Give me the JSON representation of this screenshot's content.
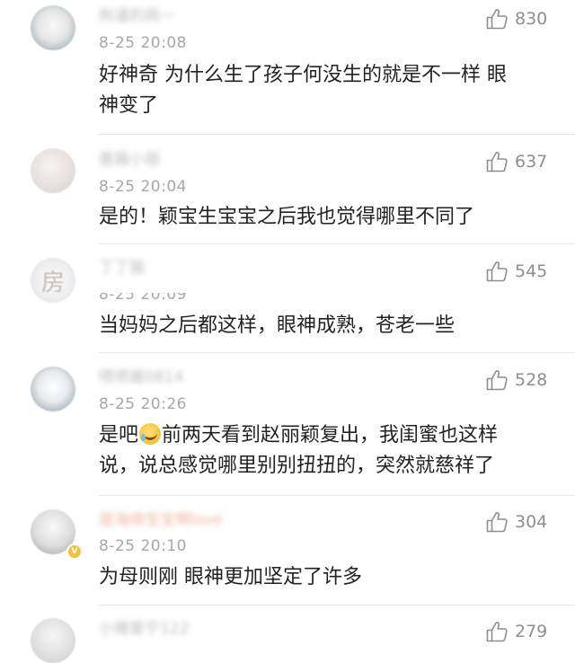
{
  "comments": [
    {
      "username": "拘谨的雨一",
      "timestamp": "8-25 20:08",
      "likes": "830",
      "text": "好神奇 为什么生了孩子何没生的就是不一样 眼\n神变了",
      "avatar_icon": "avatar-icon"
    },
    {
      "username": "蔷薇小丽",
      "timestamp": "8-25 20:04",
      "likes": "637",
      "text": "是的！颖宝生宝宝之后我也觉得哪里不同了",
      "avatar_icon": "avatar-icon"
    },
    {
      "username": "丁丁猫",
      "timestamp": "8-25 20:09",
      "likes": "545",
      "text": "当妈妈之后都这样，眼神成熟，苍老一些",
      "avatar_icon": "avatar-icon",
      "avatar_glyph": "房"
    },
    {
      "username": "喷喷酱0814",
      "timestamp": "8-25 20:26",
      "likes": "528",
      "text_before_emoji": "是吧",
      "emoji_icon": "laugh-cry-emoji-icon",
      "text_after_emoji": "前两天看到赵丽颖复出，我闺蜜也这样\n说，说总感觉哪里别别扭扭的，突然就慈祥了",
      "avatar_icon": "avatar-icon"
    },
    {
      "username": "是海绵宝宝啊love",
      "timestamp": "8-25 20:10",
      "likes": "304",
      "text": "为母则刚 眼神更加坚定了许多",
      "avatar_icon": "avatar-icon",
      "verified": true
    },
    {
      "username": "小猪爱宁122",
      "timestamp": "",
      "likes": "279",
      "text": "",
      "avatar_icon": "avatar-icon"
    }
  ],
  "icons": {
    "like": "thumbs-up-icon"
  },
  "colors": {
    "text": "#222222",
    "meta": "#a7a7a7",
    "like_count": "#8e8e8e",
    "vip_name": "#f0b7a0",
    "verified_badge": "#f2c23a"
  }
}
